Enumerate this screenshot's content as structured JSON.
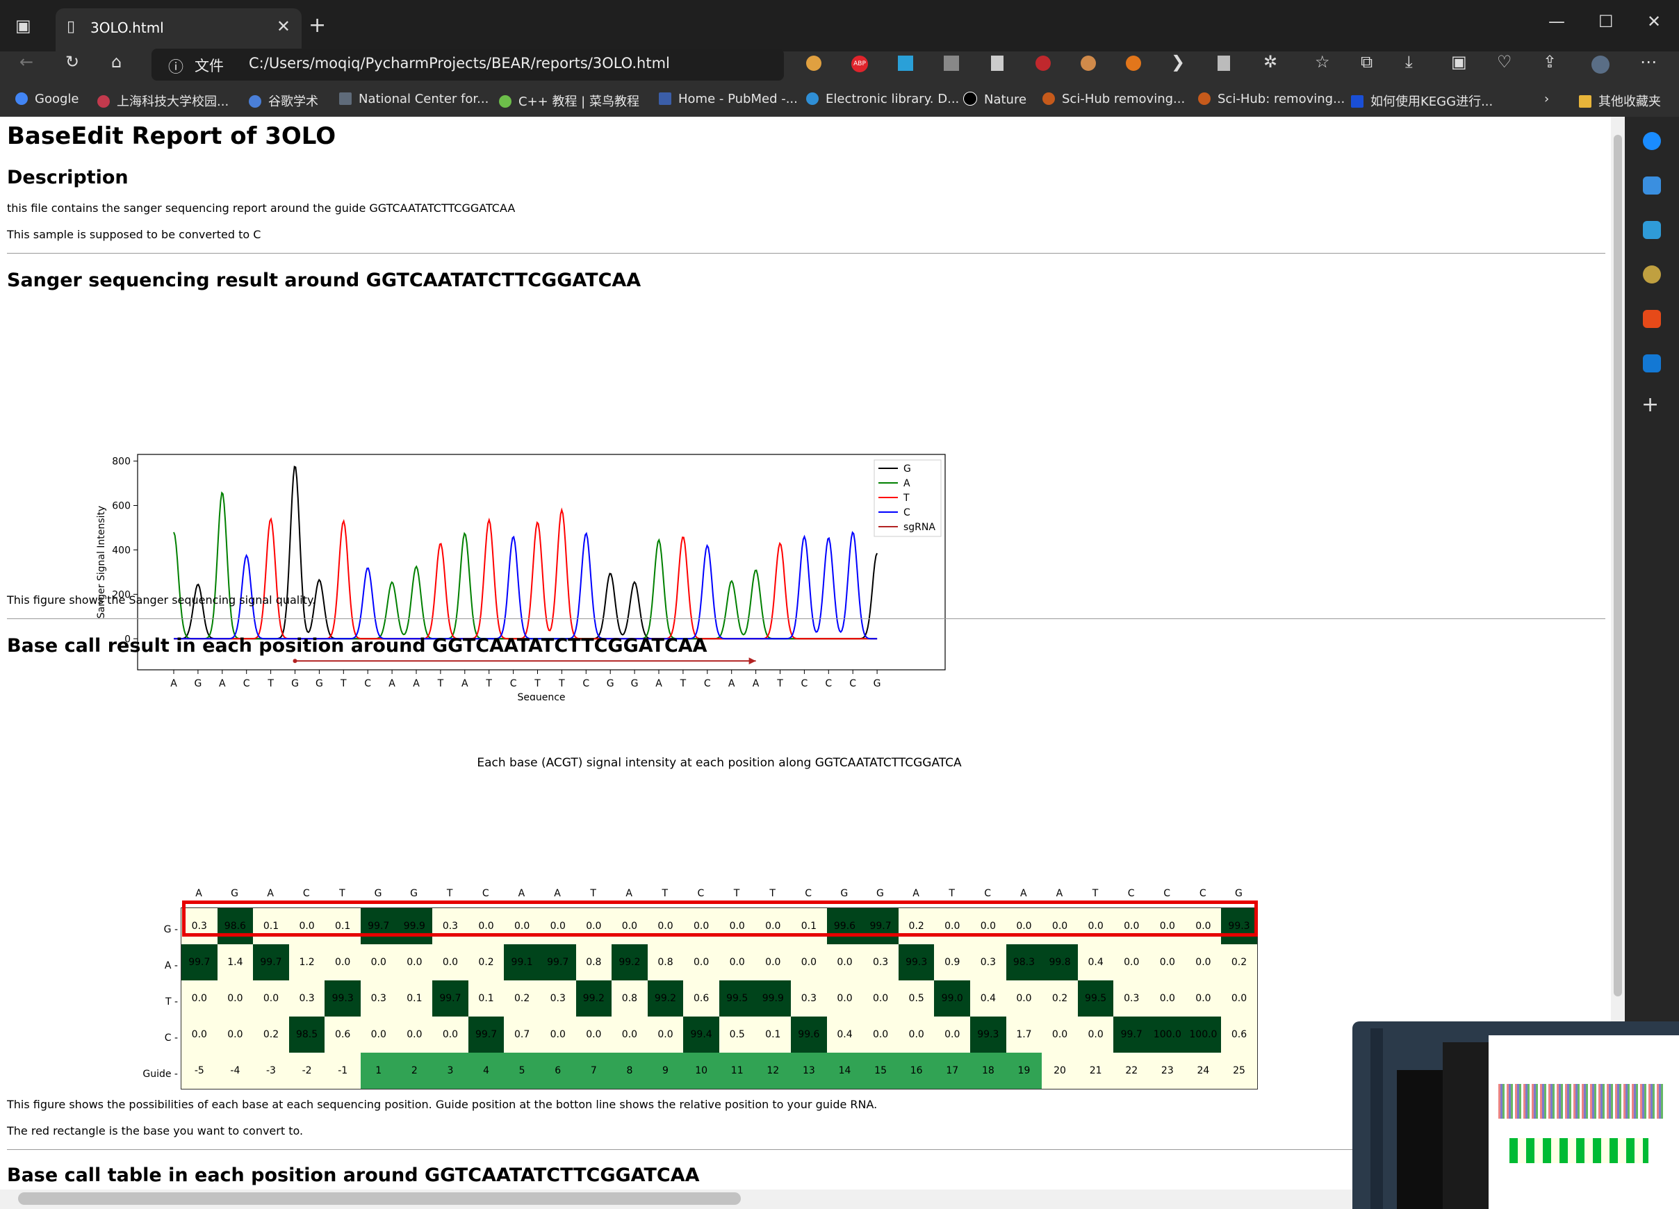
{
  "browser": {
    "tab_title": "3OLO.html",
    "address_label": "文件",
    "url": "C:/Users/moqiq/PycharmProjects/BEAR/reports/3OLO.html",
    "bookmarks": [
      {
        "label": "Google",
        "color": "#4285f4"
      },
      {
        "label": "上海科技大学校园...",
        "color": "#c23a4d"
      },
      {
        "label": "谷歌学术",
        "color": "#4a7fd8"
      },
      {
        "label": "National Center for...",
        "color": "#5f6b7a"
      },
      {
        "label": "C++ 教程 | 菜鸟教程",
        "color": "#6dbe4a"
      },
      {
        "label": "Home - PubMed -...",
        "color": "#3b5ea8"
      },
      {
        "label": "Electronic library. D...",
        "color": "#2f8fd6"
      },
      {
        "label": "Nature",
        "color": "#000000"
      },
      {
        "label": "Sci-Hub  removing...",
        "color": "#c65a1b"
      },
      {
        "label": "Sci-Hub: removing...",
        "color": "#c65a1b"
      },
      {
        "label": "如何使用KEGG进行...",
        "color": "#1a4fd6"
      }
    ],
    "other_bookmarks": "其他收藏夹"
  },
  "report": {
    "title": "BaseEdit Report of 3OLO",
    "description_heading": "Description",
    "desc_line1": "this file contains the sanger sequencing report around the guide GGTCAATATCTTCGGATCAA",
    "desc_line2": "This sample is supposed to be converted to C",
    "sanger_heading": "Sanger sequencing result around GGTCAATATCTTCGGATCAA",
    "sanger_caption": "This figure shows the Sanger sequencing signal quality.",
    "basecall_heading": "Base call result in each position around GGTCAATATCTTCGGATCAA",
    "basecall_caption1": "This figure shows the possibilities of each base at each sequencing position. Guide position at the botton line shows the relative position to your guide RNA.",
    "basecall_caption2": "The red rectangle is the base you want to convert to.",
    "table_heading": "Base call table in each position around GGTCAATATCTTCGGATCAA"
  },
  "chart_data": [
    {
      "type": "line",
      "ylabel": "Sanger Signal Intensity",
      "xlabel": "Sequence",
      "ylim": [
        -140,
        830
      ],
      "yticks": [
        0,
        200,
        400,
        600,
        800
      ],
      "legend_placement": "top-right",
      "legend": [
        "G",
        "A",
        "T",
        "C",
        "sgRNA"
      ],
      "colors": {
        "G": "#000000",
        "A": "#008000",
        "T": "#ff0000",
        "C": "#0000ff",
        "sgRNA": "#b22222"
      },
      "sequence": [
        "A",
        "G",
        "A",
        "C",
        "T",
        "G",
        "G",
        "T",
        "C",
        "A",
        "A",
        "T",
        "A",
        "T",
        "C",
        "T",
        "T",
        "C",
        "G",
        "G",
        "A",
        "T",
        "C",
        "A",
        "A",
        "T",
        "C",
        "C",
        "C",
        "G"
      ],
      "peaks": [
        480,
        245,
        660,
        375,
        540,
        780,
        265,
        530,
        320,
        255,
        325,
        430,
        475,
        535,
        460,
        525,
        580,
        475,
        295,
        255,
        445,
        460,
        420,
        260,
        310,
        430,
        460,
        455,
        480,
        385
      ],
      "sgRNA_range": [
        5,
        24
      ]
    },
    {
      "type": "heatmap",
      "title": "Each base (ACGT) signal intensity at each position along GGTCAATATCTTCGGATCA",
      "columns": [
        "A",
        "G",
        "A",
        "C",
        "T",
        "G",
        "G",
        "T",
        "C",
        "A",
        "A",
        "T",
        "A",
        "T",
        "C",
        "T",
        "T",
        "C",
        "G",
        "G",
        "A",
        "T",
        "C",
        "A",
        "A",
        "T",
        "C",
        "C",
        "C",
        "G"
      ],
      "rows": [
        "G",
        "A",
        "T",
        "C",
        "Guide"
      ],
      "values": {
        "G": [
          0.3,
          98.6,
          0.1,
          0.0,
          0.1,
          99.7,
          99.9,
          0.3,
          0.0,
          0.0,
          0.0,
          0.0,
          0.0,
          0.0,
          0.0,
          0.0,
          0.0,
          0.1,
          99.6,
          99.7,
          0.2,
          0.0,
          0.0,
          0.0,
          0.0,
          0.0,
          0.0,
          0.0,
          0.0,
          99.3
        ],
        "A": [
          99.7,
          1.4,
          99.7,
          1.2,
          0.0,
          0.0,
          0.0,
          0.0,
          0.2,
          99.1,
          99.7,
          0.8,
          99.2,
          0.8,
          0.0,
          0.0,
          0.0,
          0.0,
          0.0,
          0.3,
          99.3,
          0.9,
          0.3,
          98.3,
          99.8,
          0.4,
          0.0,
          0.0,
          0.0,
          0.2
        ],
        "T": [
          0.0,
          0.0,
          0.0,
          0.3,
          99.3,
          0.3,
          0.1,
          99.7,
          0.1,
          0.2,
          0.3,
          99.2,
          0.8,
          99.2,
          0.6,
          99.5,
          99.9,
          0.3,
          0.0,
          0.0,
          0.5,
          99.0,
          0.4,
          0.0,
          0.2,
          99.5,
          0.3,
          0.0,
          0.0,
          0.0
        ],
        "C": [
          0.0,
          0.0,
          0.2,
          98.5,
          0.6,
          0.0,
          0.0,
          0.0,
          99.7,
          0.7,
          0.0,
          0.0,
          0.0,
          0.0,
          99.4,
          0.5,
          0.1,
          99.6,
          0.4,
          0.0,
          0.0,
          0.0,
          99.3,
          1.7,
          0.0,
          0.0,
          99.7,
          100.0,
          100.0,
          0.6
        ]
      },
      "guide": [
        -5,
        -4,
        -3,
        -2,
        -1,
        1,
        2,
        3,
        4,
        5,
        6,
        7,
        8,
        9,
        10,
        11,
        12,
        13,
        14,
        15,
        16,
        17,
        18,
        19,
        20,
        21,
        22,
        23,
        24,
        25
      ],
      "highlight_row": "C",
      "colors": {
        "high": "#00441b",
        "low": "#ffffe5",
        "guide": "#31a354"
      }
    }
  ]
}
